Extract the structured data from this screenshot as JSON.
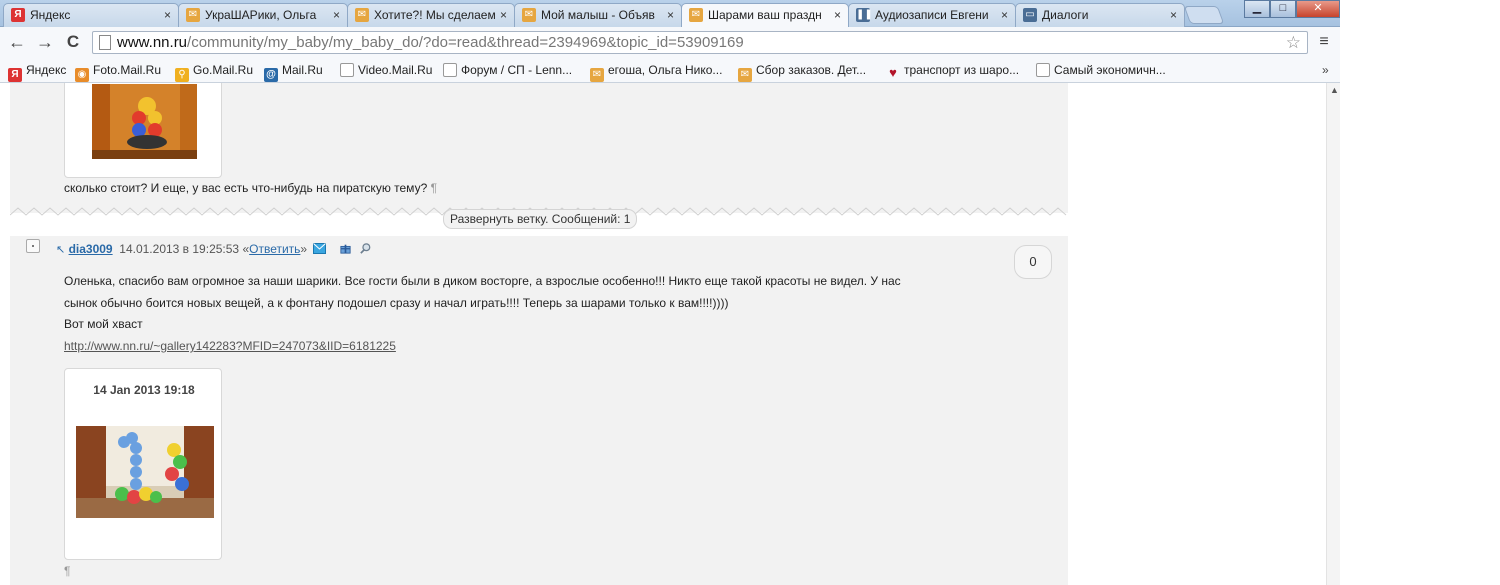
{
  "tabs": [
    {
      "title": "Яндекс",
      "icon": "yandex-icon",
      "active": false
    },
    {
      "title": "УкраШАРики, Ольга",
      "icon": "forum-icon",
      "active": false
    },
    {
      "title": "Хотите?! Мы сделаем",
      "icon": "forum-icon",
      "active": false
    },
    {
      "title": "Мой малыш - Объяв",
      "icon": "forum-icon",
      "active": false
    },
    {
      "title": "Шарами ваш праздн",
      "icon": "forum-icon",
      "active": true
    },
    {
      "title": "Аудиозаписи Евгени",
      "icon": "audio-icon",
      "active": false
    },
    {
      "title": "Диалоги",
      "icon": "vk-dialog-icon",
      "active": false
    }
  ],
  "tab_close_glyph": "×",
  "window": {
    "minimize": "▁",
    "maximize": "□",
    "close": "✕"
  },
  "address": {
    "host": "www.nn.ru",
    "path": "/community/my_baby/my_baby_do/?do=read&thread=2394969&topic_id=53909169"
  },
  "nav": {
    "back": "←",
    "forward": "→",
    "reload": "C",
    "star": "☆",
    "menu": "≡"
  },
  "bookmarks": [
    {
      "label": "Яндекс",
      "icon": "yandex-icon"
    },
    {
      "label": "Foto.Mail.Ru",
      "icon": "foto-mail-icon"
    },
    {
      "label": "Go.Mail.Ru",
      "icon": "go-mail-icon"
    },
    {
      "label": "Mail.Ru",
      "icon": "mail-ru-icon"
    },
    {
      "label": "Video.Mail.Ru",
      "icon": "page-icon"
    },
    {
      "label": "Форум / СП - Lenn...",
      "icon": "page-icon"
    },
    {
      "label": "егоша, Ольга Нико...",
      "icon": "forum-icon"
    },
    {
      "label": "Сбор заказов. Дет...",
      "icon": "forum-icon"
    },
    {
      "label": "транспорт из шаро...",
      "icon": "heart-icon"
    },
    {
      "label": "Самый экономичн...",
      "icon": "page-icon"
    }
  ],
  "bookmarks_more": "»",
  "post1": {
    "text": "сколько стоит? И еще, у вас есть что-нибудь на пиратскую тему?",
    "pilcrow": "¶"
  },
  "expand_thread": "Развернуть ветку. Сообщений: 1",
  "post2": {
    "arrow": "↖",
    "author": "dia3009",
    "datetime": "14.01.2013 в 19:25:53",
    "reply_open": "«",
    "reply": "Ответить",
    "reply_close": "»",
    "rating": "0",
    "lines": [
      "Оленька, спасибо вам огромное за наши шарики. Все гости были в диком восторге, а взрослые особенно!!! Никто еще такой красоты не видел. У нас",
      "сынок обычно боится новых вещей, а к фонтану подошел сразу и начал играть!!!! Теперь за шарами только к вам!!!!))))",
      "Вот мой хваст"
    ],
    "link": "http://www.nn.ru/~gallery142283?MFID=247073&IID=6181225",
    "photo_date": "14 Jan 2013 19:18",
    "pilcrow": "¶"
  },
  "colors": {
    "accent_link": "#2a6aa8",
    "post_bg": "#f2f2f2"
  }
}
